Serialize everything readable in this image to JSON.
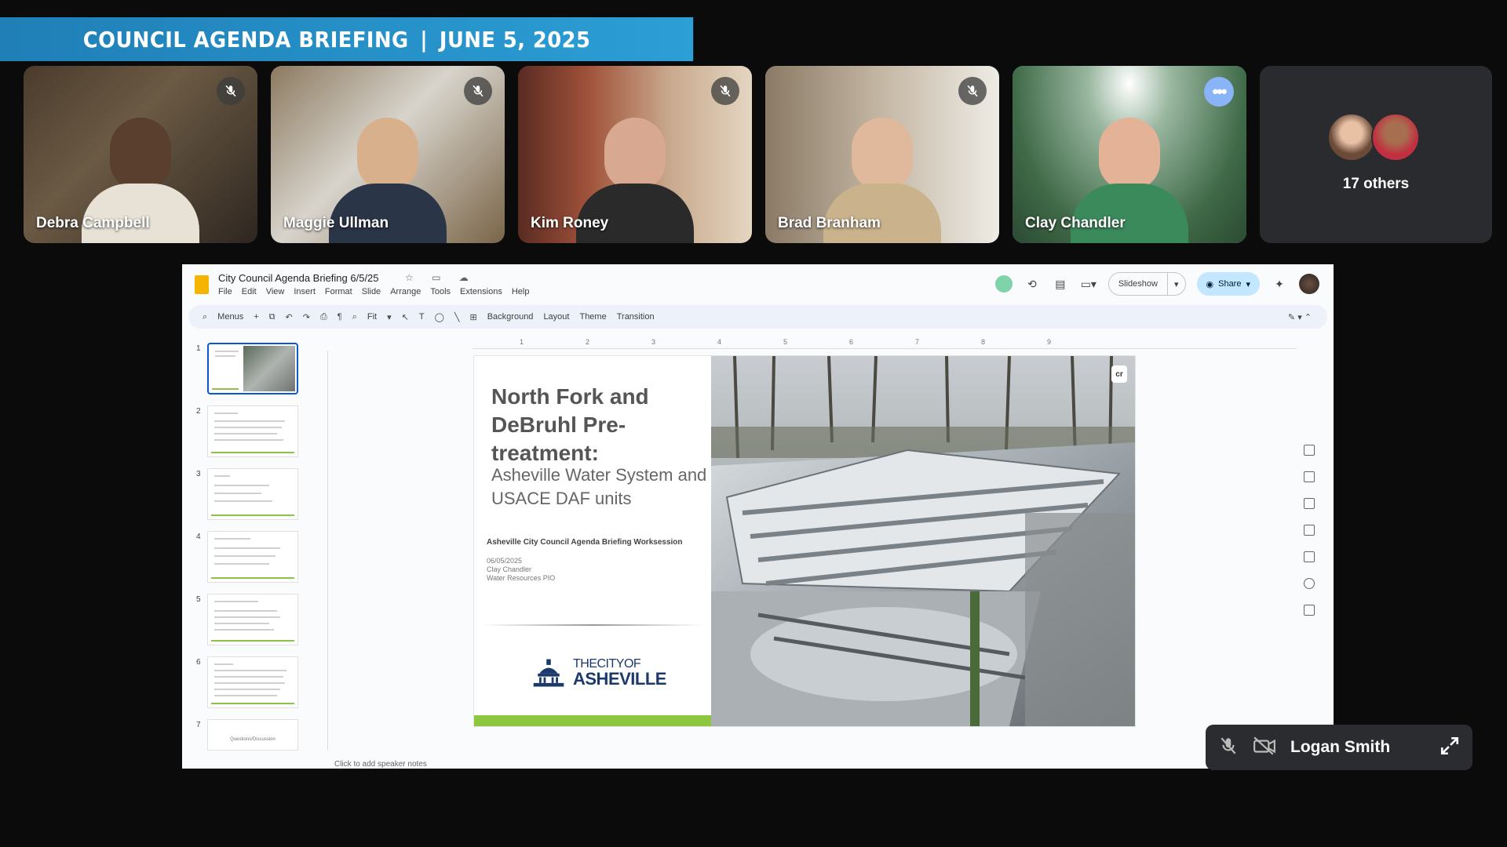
{
  "banner": {
    "left": "COUNCIL AGENDA BRIEFING",
    "separator": "|",
    "right": "JUNE 5, 2025"
  },
  "participants": [
    {
      "name": "Debra Campbell",
      "muted": true
    },
    {
      "name": "Maggie Ullman",
      "muted": true
    },
    {
      "name": "Kim Roney",
      "muted": true
    },
    {
      "name": "Brad Branham",
      "muted": true
    },
    {
      "name": "Clay Chandler",
      "muted": false,
      "active": true
    }
  ],
  "others": {
    "label": "17 others"
  },
  "slides_app": {
    "doc_title": "City Council Agenda Briefing 6/5/25",
    "menu": [
      "File",
      "Edit",
      "View",
      "Insert",
      "Format",
      "Slide",
      "Arrange",
      "Tools",
      "Extensions",
      "Help"
    ],
    "slideshow_label": "Slideshow",
    "share_label": "Share",
    "toolbar": {
      "menus": "Menus",
      "zoom": "Fit",
      "background": "Background",
      "layout": "Layout",
      "theme": "Theme",
      "transition": "Transition"
    },
    "ruler_marks": [
      "1",
      "2",
      "3",
      "4",
      "5",
      "6",
      "7",
      "8",
      "9"
    ],
    "thumbnail_numbers": [
      "1",
      "2",
      "3",
      "4",
      "5",
      "6",
      "7"
    ],
    "thumbnail_7_text": "Questions/Discussion",
    "notes_placeholder": "Click to add speaker notes"
  },
  "slide": {
    "title": "North Fork and DeBruhl Pre-treatment:",
    "subtitle": "Asheville Water System and USACE DAF units",
    "briefing": "Asheville City Council Agenda Briefing Worksession",
    "date": "06/05/2025",
    "presenter": "Clay Chandler",
    "role": "Water Resources PIO",
    "logo_top": "THECITYOF",
    "logo_bottom": "ASHEVILLE",
    "photo_badge": "cr"
  },
  "self_view": {
    "name": "Logan Smith"
  },
  "colors": {
    "banner": "#2c9fd6",
    "active_outline": "#8ab4f8",
    "slide_green": "#8dc63f",
    "share_bg": "#c2e7ff"
  }
}
